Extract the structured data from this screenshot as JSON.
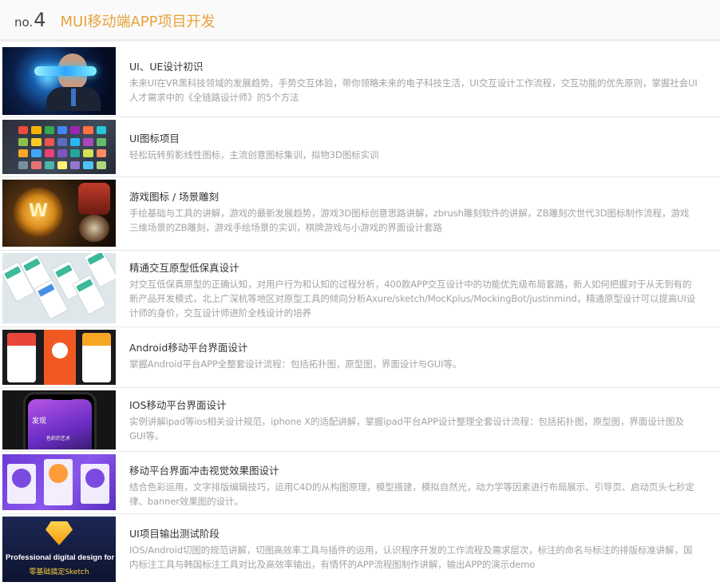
{
  "header": {
    "no_prefix": "no.",
    "no_number": "4",
    "title": "MUI移动端APP项目开发"
  },
  "colors": {
    "accent": "#e8a23c",
    "desc_gray": "#a3a3a3"
  },
  "items": [
    {
      "title": "UI、UE设计初识",
      "desc": "未来UI在VR黑科技领域的发展趋势，手势交互体验，带你领略未来的电子科技生活，UI交互设计工作流程，交互功能的优先原则，掌握社会UI人才需求中的《全链路设计师》的5个方法"
    },
    {
      "title": "UI图标项目",
      "desc": "轻松玩转剪影线性图标，主流创意图标集训，拟物3D图标实训"
    },
    {
      "title": "游戏图标 / 场景雕刻",
      "desc": "手绘基础与工具的讲解，游戏的最新发展趋势，游戏3D图标创意思路讲解，zbrush雕刻软件的讲解，ZB雕刻次世代3D图标制作流程，游戏三维场景的ZB雕刻，游戏手绘场景的实训，棋牌游戏与小游戏的界面设计套路"
    },
    {
      "title": "精通交互原型低保真设计",
      "desc": "对交互低保真原型的正确认知，对用户行为和认知的过程分析，400款APP交互设计中的功能优先级布局套路，新人如何把握对于从无到有的新产品开发模式，北上广深杭等地区对原型工具的倾向分析Axure/sketch/MocKplus/MockingBot/justinmind，精通原型设计可以提高UI设计师的身价，交互设计师进阶全栈设计的培养"
    },
    {
      "title": "Android移动平台界面设计",
      "desc": "掌握Android平台APP全整套设计流程：包括拓扑图，原型图，界面设计与GUI等。"
    },
    {
      "title": "IOS移动平台界面设计",
      "desc": "实例讲解ipad等ios相关设计规范，iphone X的适配讲解，掌握ipad平台APP设计整理全套设计流程：包括拓扑图，原型图，界面设计图及GUI等。"
    },
    {
      "title": "移动平台界面冲击视觉效果图设计",
      "desc": "结合色彩运用，文字排版编辑技巧，运用C4D的从构图原理，模型搭建，模拟自然光，动力学等因素进行布局展示、引导页、启动页头七秒定律、banner效果图的设计。"
    },
    {
      "title": "UI项目输出测试阶段",
      "desc": "IOS/Android切图的规范讲解，切图高效率工具与插件的运用，认识程序开发的工作流程及需求层次，标注的命名与标注的排版标准讲解，国内标注工具与韩国标注工具对比及高效率输出，有情怀的APP流程图制作讲解，输出APP的演示demo"
    }
  ],
  "thumb_texts": {
    "ios_app_title": "发现",
    "ios_app_caption": "色彩的艺术",
    "sketch_line1": "Professional digital design for Mac",
    "sketch_line2": "零基础搞定Sketch"
  }
}
